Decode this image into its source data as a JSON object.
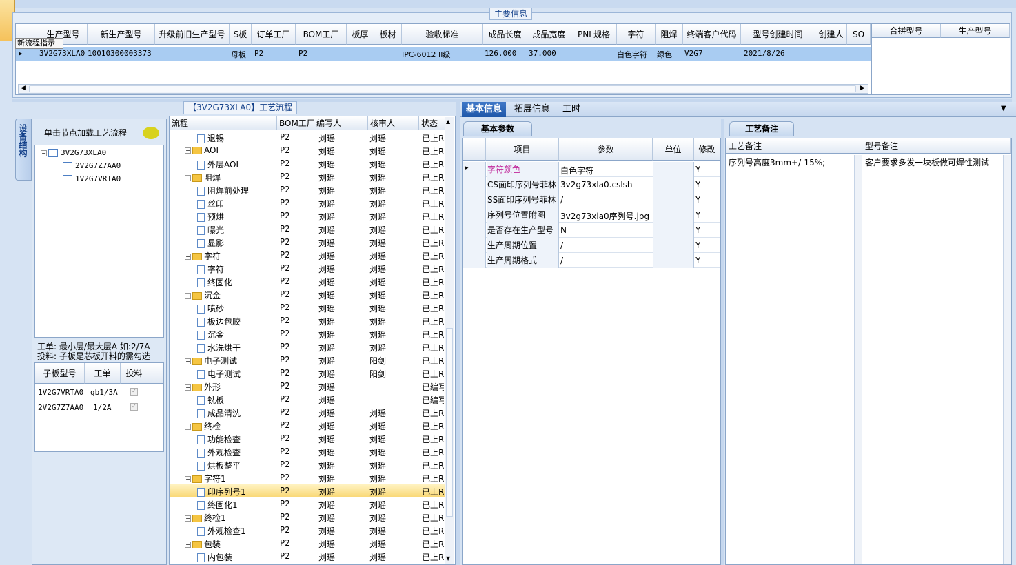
{
  "main_group": {
    "title": "主要信息"
  },
  "tooltip": "新流程指示",
  "main_grid": {
    "columns": [
      "生产型号",
      "新生产型号",
      "升级前旧生产型号",
      "S板",
      "订单工厂",
      "BOM工厂",
      "板厚",
      "板材",
      "验收标准",
      "成品长度",
      "成品宽度",
      "PNL规格",
      "字符",
      "阻焊",
      "终端客户代码",
      "型号创建时间",
      "创建人",
      "SO"
    ],
    "row": {
      "model": "3V2G73XLA0",
      "new_model": "10010300003373",
      "s_board": "母板",
      "order_factory": "P2",
      "bom_factory": "P2",
      "standard": "IPC-6012 II级",
      "length": "126.000",
      "width": "37.000",
      "char": "白色字符",
      "solder": "绿色",
      "customer": "V2G7",
      "created": "2021/8/26"
    }
  },
  "merge_grid": {
    "columns": [
      "合拼型号",
      "生产型号"
    ]
  },
  "left_panel": {
    "vtab": "设备结构",
    "hint": "单击节点加载工艺流程",
    "tree": [
      "3V2G73XLA0",
      "2V2G7Z7AA0",
      "1V2G7VRTA0"
    ],
    "note_line1": "工单: 最小层/最大层A 如:2/7A",
    "note_line2": "投料: 子板是芯板开料的需勾选",
    "sub_grid": {
      "columns": [
        "子板型号",
        "工单",
        "投料"
      ],
      "rows": [
        {
          "model": "1V2G7VRTA0",
          "order": "gb1/3A"
        },
        {
          "model": "2V2G7Z7AA0",
          "order": "1/2A"
        }
      ]
    }
  },
  "process": {
    "title": "【3V2G73XLA0】工艺流程",
    "columns": [
      "流程",
      "BOM工厂",
      "编写人",
      "核审人",
      "状态"
    ],
    "rows": [
      {
        "name": "退锡",
        "type": "doc",
        "bom": "P2",
        "writer": "刘瑶",
        "reviewer": "刘瑶",
        "status": "已上R"
      },
      {
        "name": "AOI",
        "type": "folder",
        "bom": "P2",
        "writer": "刘瑶",
        "reviewer": "刘瑶",
        "status": "已上R"
      },
      {
        "name": "外层AOI",
        "type": "doc",
        "bom": "P2",
        "writer": "刘瑶",
        "reviewer": "刘瑶",
        "status": "已上R"
      },
      {
        "name": "阻焊",
        "type": "folder",
        "bom": "P2",
        "writer": "刘瑶",
        "reviewer": "刘瑶",
        "status": "已上R"
      },
      {
        "name": "阻焊前处理",
        "type": "doc",
        "bom": "P2",
        "writer": "刘瑶",
        "reviewer": "刘瑶",
        "status": "已上R"
      },
      {
        "name": "丝印",
        "type": "doc",
        "bom": "P2",
        "writer": "刘瑶",
        "reviewer": "刘瑶",
        "status": "已上R"
      },
      {
        "name": "预烘",
        "type": "doc",
        "bom": "P2",
        "writer": "刘瑶",
        "reviewer": "刘瑶",
        "status": "已上R"
      },
      {
        "name": "曝光",
        "type": "doc",
        "bom": "P2",
        "writer": "刘瑶",
        "reviewer": "刘瑶",
        "status": "已上R"
      },
      {
        "name": "显影",
        "type": "doc",
        "bom": "P2",
        "writer": "刘瑶",
        "reviewer": "刘瑶",
        "status": "已上R"
      },
      {
        "name": "字符",
        "type": "folder",
        "bom": "P2",
        "writer": "刘瑶",
        "reviewer": "刘瑶",
        "status": "已上R"
      },
      {
        "name": "字符",
        "type": "doc",
        "bom": "P2",
        "writer": "刘瑶",
        "reviewer": "刘瑶",
        "status": "已上R"
      },
      {
        "name": "终固化",
        "type": "doc",
        "bom": "P2",
        "writer": "刘瑶",
        "reviewer": "刘瑶",
        "status": "已上R"
      },
      {
        "name": "沉金",
        "type": "folder",
        "bom": "P2",
        "writer": "刘瑶",
        "reviewer": "刘瑶",
        "status": "已上R"
      },
      {
        "name": "喷砂",
        "type": "doc",
        "bom": "P2",
        "writer": "刘瑶",
        "reviewer": "刘瑶",
        "status": "已上R"
      },
      {
        "name": "板边包胶",
        "type": "doc",
        "bom": "P2",
        "writer": "刘瑶",
        "reviewer": "刘瑶",
        "status": "已上R"
      },
      {
        "name": "沉金",
        "type": "doc",
        "bom": "P2",
        "writer": "刘瑶",
        "reviewer": "刘瑶",
        "status": "已上R"
      },
      {
        "name": "水洗烘干",
        "type": "doc",
        "bom": "P2",
        "writer": "刘瑶",
        "reviewer": "刘瑶",
        "status": "已上R"
      },
      {
        "name": "电子测试",
        "type": "folder",
        "bom": "P2",
        "writer": "刘瑶",
        "reviewer": "阳剑",
        "status": "已上R"
      },
      {
        "name": "电子测试",
        "type": "doc",
        "bom": "P2",
        "writer": "刘瑶",
        "reviewer": "阳剑",
        "status": "已上R"
      },
      {
        "name": "外形",
        "type": "folder",
        "bom": "P2",
        "writer": "刘瑶",
        "reviewer": "",
        "status": "已编写"
      },
      {
        "name": "铣板",
        "type": "doc",
        "bom": "P2",
        "writer": "刘瑶",
        "reviewer": "",
        "status": "已编写"
      },
      {
        "name": "成品清洗",
        "type": "doc",
        "bom": "P2",
        "writer": "刘瑶",
        "reviewer": "刘瑶",
        "status": "已上R"
      },
      {
        "name": "终检",
        "type": "folder",
        "bom": "P2",
        "writer": "刘瑶",
        "reviewer": "刘瑶",
        "status": "已上R"
      },
      {
        "name": "功能检查",
        "type": "doc",
        "bom": "P2",
        "writer": "刘瑶",
        "reviewer": "刘瑶",
        "status": "已上R"
      },
      {
        "name": "外观检查",
        "type": "doc",
        "bom": "P2",
        "writer": "刘瑶",
        "reviewer": "刘瑶",
        "status": "已上R"
      },
      {
        "name": "烘板整平",
        "type": "doc",
        "bom": "P2",
        "writer": "刘瑶",
        "reviewer": "刘瑶",
        "status": "已上R"
      },
      {
        "name": "字符1",
        "type": "folder",
        "bom": "P2",
        "writer": "刘瑶",
        "reviewer": "刘瑶",
        "status": "已上R"
      },
      {
        "name": "印序列号1",
        "type": "doc",
        "bom": "P2",
        "writer": "刘瑶",
        "reviewer": "刘瑶",
        "status": "已上R",
        "selected": true
      },
      {
        "name": "终固化1",
        "type": "doc",
        "bom": "P2",
        "writer": "刘瑶",
        "reviewer": "刘瑶",
        "status": "已上R"
      },
      {
        "name": "终检1",
        "type": "folder",
        "bom": "P2",
        "writer": "刘瑶",
        "reviewer": "刘瑶",
        "status": "已上R"
      },
      {
        "name": "外观检查1",
        "type": "doc",
        "bom": "P2",
        "writer": "刘瑶",
        "reviewer": "刘瑶",
        "status": "已上R"
      },
      {
        "name": "包装",
        "type": "folder",
        "bom": "P2",
        "writer": "刘瑶",
        "reviewer": "刘瑶",
        "status": "已上R"
      },
      {
        "name": "内包装",
        "type": "doc",
        "bom": "P2",
        "writer": "刘瑶",
        "reviewer": "刘瑶",
        "status": "已上R"
      }
    ]
  },
  "tabs": [
    "基本信息",
    "拓展信息",
    "工时"
  ],
  "params": {
    "subtab": "基本参数",
    "columns": [
      "项目",
      "参数",
      "单位",
      "修改"
    ],
    "rows": [
      {
        "item": "字符颜色",
        "value": "白色字符",
        "unit": "",
        "mod": "Y"
      },
      {
        "item": "CS面印序列号菲林",
        "value": "3v2g73xla0.cslsh",
        "unit": "",
        "mod": "Y"
      },
      {
        "item": "SS面印序列号菲林",
        "value": "/",
        "unit": "",
        "mod": "Y"
      },
      {
        "item": "序列号位置附图",
        "value": "3v2g73xla0序列号.jpg",
        "unit": "",
        "mod": "Y"
      },
      {
        "item": "是否存在生产型号",
        "value": "N",
        "unit": "",
        "mod": "Y"
      },
      {
        "item": "生产周期位置",
        "value": "/",
        "unit": "",
        "mod": "Y"
      },
      {
        "item": "生产周期格式",
        "value": "/",
        "unit": "",
        "mod": "Y"
      }
    ]
  },
  "remarks": {
    "subtab": "工艺备注",
    "process_label": "工艺备注",
    "model_label": "型号备注",
    "process_text": "序列号高度3mm+/-15%;",
    "model_text": "客户要求多发一块板做可焊性测试"
  }
}
